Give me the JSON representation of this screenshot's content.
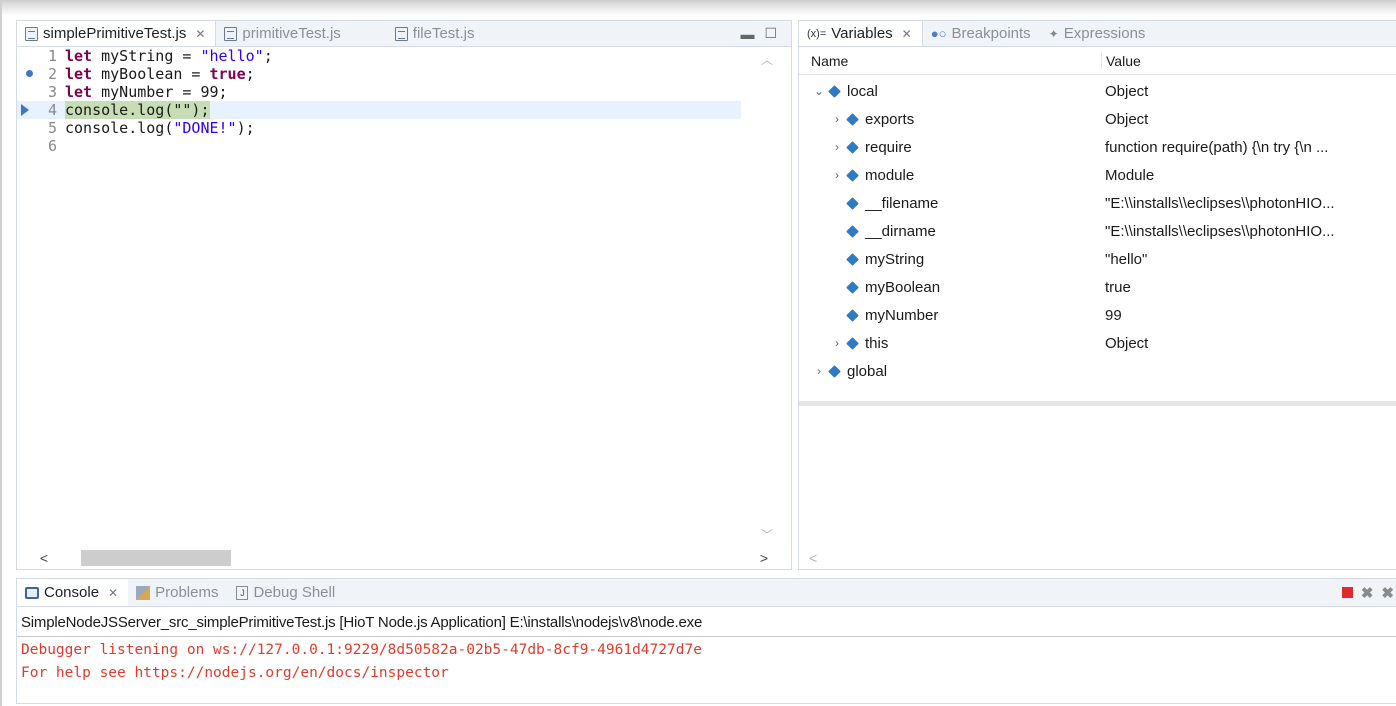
{
  "editor": {
    "tabs": [
      {
        "label": "simplePrimitiveTest.js",
        "active": true
      },
      {
        "label": "primitiveTest.js",
        "active": false
      },
      {
        "label": "fileTest.js",
        "active": false
      }
    ],
    "lines": [
      {
        "num": "1",
        "parts": [
          {
            "t": "let",
            "c": "kw"
          },
          {
            "t": " myString = "
          },
          {
            "t": "\"hello\"",
            "c": "str"
          },
          {
            "t": ";"
          }
        ]
      },
      {
        "num": "2",
        "marker": "breakpoint",
        "parts": [
          {
            "t": "let",
            "c": "kw"
          },
          {
            "t": " myBoolean = "
          },
          {
            "t": "true",
            "c": "kw"
          },
          {
            "t": ";"
          }
        ]
      },
      {
        "num": "3",
        "parts": [
          {
            "t": "let",
            "c": "kw"
          },
          {
            "t": " myNumber = 99;"
          }
        ]
      },
      {
        "num": "4",
        "marker": "current",
        "highlight": true,
        "parts": [
          {
            "t": "console.log(\"\");"
          }
        ]
      },
      {
        "num": "5",
        "parts": [
          {
            "t": "console.log("
          },
          {
            "t": "\"DONE!\"",
            "c": "str"
          },
          {
            "t": ");"
          }
        ]
      },
      {
        "num": "6",
        "parts": []
      }
    ]
  },
  "variables": {
    "tabs": [
      {
        "label": "Variables",
        "active": true,
        "icon": "x-equals-icon"
      },
      {
        "label": "Breakpoints",
        "active": false,
        "icon": "breakpoints-icon"
      },
      {
        "label": "Expressions",
        "active": false,
        "icon": "expressions-icon"
      }
    ],
    "col_name": "Name",
    "col_value": "Value",
    "rows": [
      {
        "depth": 0,
        "twisty": "expanded",
        "name": "local",
        "value": "Object"
      },
      {
        "depth": 1,
        "twisty": "collapsed",
        "name": "exports",
        "value": "Object"
      },
      {
        "depth": 1,
        "twisty": "collapsed",
        "name": "require",
        "value": "function require(path) {\\n    try {\\n ..."
      },
      {
        "depth": 1,
        "twisty": "collapsed",
        "name": "module",
        "value": "Module"
      },
      {
        "depth": 1,
        "twisty": "none",
        "name": "__filename",
        "value": "\"E:\\\\installs\\\\eclipses\\\\photonHIO..."
      },
      {
        "depth": 1,
        "twisty": "none",
        "name": "__dirname",
        "value": "\"E:\\\\installs\\\\eclipses\\\\photonHIO..."
      },
      {
        "depth": 1,
        "twisty": "none",
        "name": "myString",
        "value": "\"hello\""
      },
      {
        "depth": 1,
        "twisty": "none",
        "name": "myBoolean",
        "value": "true"
      },
      {
        "depth": 1,
        "twisty": "none",
        "name": "myNumber",
        "value": "99"
      },
      {
        "depth": 1,
        "twisty": "collapsed",
        "name": "this",
        "value": "Object"
      },
      {
        "depth": 0,
        "twisty": "collapsed",
        "name": "global",
        "value": ""
      }
    ]
  },
  "console": {
    "tabs": [
      {
        "label": "Console",
        "active": true
      },
      {
        "label": "Problems",
        "active": false
      },
      {
        "label": "Debug Shell",
        "active": false
      }
    ],
    "process": "SimpleNodeJSServer_src_simplePrimitiveTest.js [HioT Node.js Application] E:\\installs\\nodejs\\v8\\node.exe",
    "output": [
      "Debugger listening on ws://127.0.0.1:9229/8d50582a-02b5-47db-8cf9-4961d4727d7e",
      "For help see https://nodejs.org/en/docs/inspector"
    ]
  },
  "colors": {
    "keyword": "#7f0055",
    "string": "#2a00ff",
    "error_output": "#e23b2b",
    "current_line_highlight": "#c7ddb5",
    "variable_icon": "#2f79c9"
  }
}
